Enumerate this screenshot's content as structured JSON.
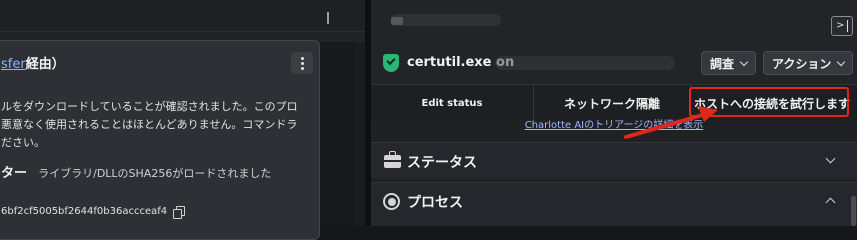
{
  "left_panel": {
    "card": {
      "title_link": "sfer",
      "title_suffix": "経由）",
      "description_lines": [
        "ルをダウンロードしていることが確認されました。このプロ",
        "悪意なく使用されることはほとんどありません。コマンドラ",
        "ださい。"
      ],
      "indicator_label": "ター",
      "indicator_value": "ライブラリ/DLLのSHA256がロードされました",
      "hash_value": "6bf2cf5005bf2644f0b36accceaf4"
    }
  },
  "right_panel": {
    "header": {
      "title": "certutil.exe on",
      "status_color": "#2bb673"
    },
    "buttons": {
      "investigate_label": "調査",
      "actions_label": "アクション"
    },
    "tabs": {
      "edit_status": "Edit status",
      "network_isolate": "ネットワーク隔離",
      "connect_host": "ホストへの接続を試行します"
    },
    "triage_link": "Charlotte AIのトリアージの詳細を表示",
    "sections": {
      "status": "ステータス",
      "process": "プロセス"
    },
    "highlight_color": "#e2261c"
  },
  "icons": [
    "shield-check-icon",
    "briefcase-icon",
    "radio-target-icon",
    "copy-icon",
    "kebab-menu-icon",
    "collapse-panel-icon",
    "chevron-down-icon",
    "chevron-up-icon"
  ]
}
